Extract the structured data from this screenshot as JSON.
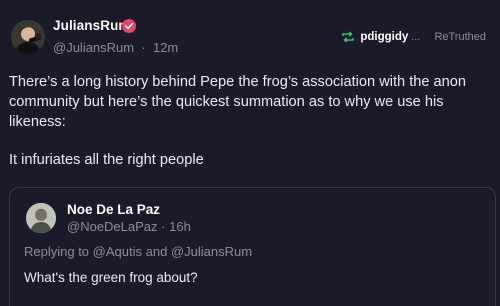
{
  "post": {
    "author_name": "JuliansRum",
    "author_handle": "@JuliansRum",
    "separator": "·",
    "time": "12m",
    "retweeted_by": "pdiggidy",
    "retweeted_by_suffix": "...",
    "retweet_label": "ReTruthed",
    "body": "There’s a long history behind Pepe the frog’s association with the anon community but here’s the quickest summation as to why we use his likeness:",
    "body2": "It infuriates all the right people",
    "accent_color": "#2ec07a",
    "verified_color": "#e8436a"
  },
  "quote": {
    "author_name": "Noe De La Paz",
    "author_handle": "@NoeDeLaPaz",
    "separator": "·",
    "time": "16h",
    "reply_prefix": "Replying to",
    "reply_user1": "@Aqutis",
    "reply_and": "and",
    "reply_user2": "@JuliansRum",
    "body": "What's the green frog about?"
  }
}
